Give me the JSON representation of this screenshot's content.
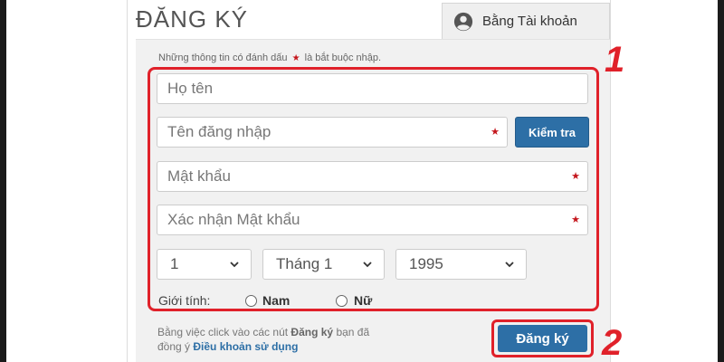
{
  "page": {
    "title": "ĐĂNG KÝ",
    "tab_label": "Bằng Tài khoản"
  },
  "note": {
    "prefix": "Những thông tin có đánh dấu",
    "star": "★",
    "suffix": "là bắt buộc nhập."
  },
  "fields": {
    "full_name_placeholder": "Họ tên",
    "username_placeholder": "Tên đăng nhập",
    "password_placeholder": "Mật khẩu",
    "confirm_password_placeholder": "Xác nhận Mật khẩu",
    "required_mark": "★"
  },
  "check_button": "Kiểm tra",
  "birthdate": {
    "day": "1",
    "month": "Tháng 1",
    "year": "1995"
  },
  "gender": {
    "label": "Giới tính:",
    "options": [
      "Nam",
      "Nữ"
    ]
  },
  "terms": {
    "line1_prefix": "Bằng việc click vào các nút",
    "line1_bold": "Đăng ký",
    "line1_suffix": "bạn đã",
    "line2_prefix": "đồng ý",
    "line2_link": "Điều khoản sử dụng"
  },
  "submit_button": "Đăng ký",
  "annotations": {
    "num1": "1",
    "num2": "2"
  },
  "colors": {
    "accent_blue": "#2d6fa6",
    "annotation_red": "#e0212a",
    "required_red": "#c4161c"
  },
  "icons": {
    "tab_icon": "user-circle-icon",
    "select_icon": "chevron-down-icon"
  }
}
